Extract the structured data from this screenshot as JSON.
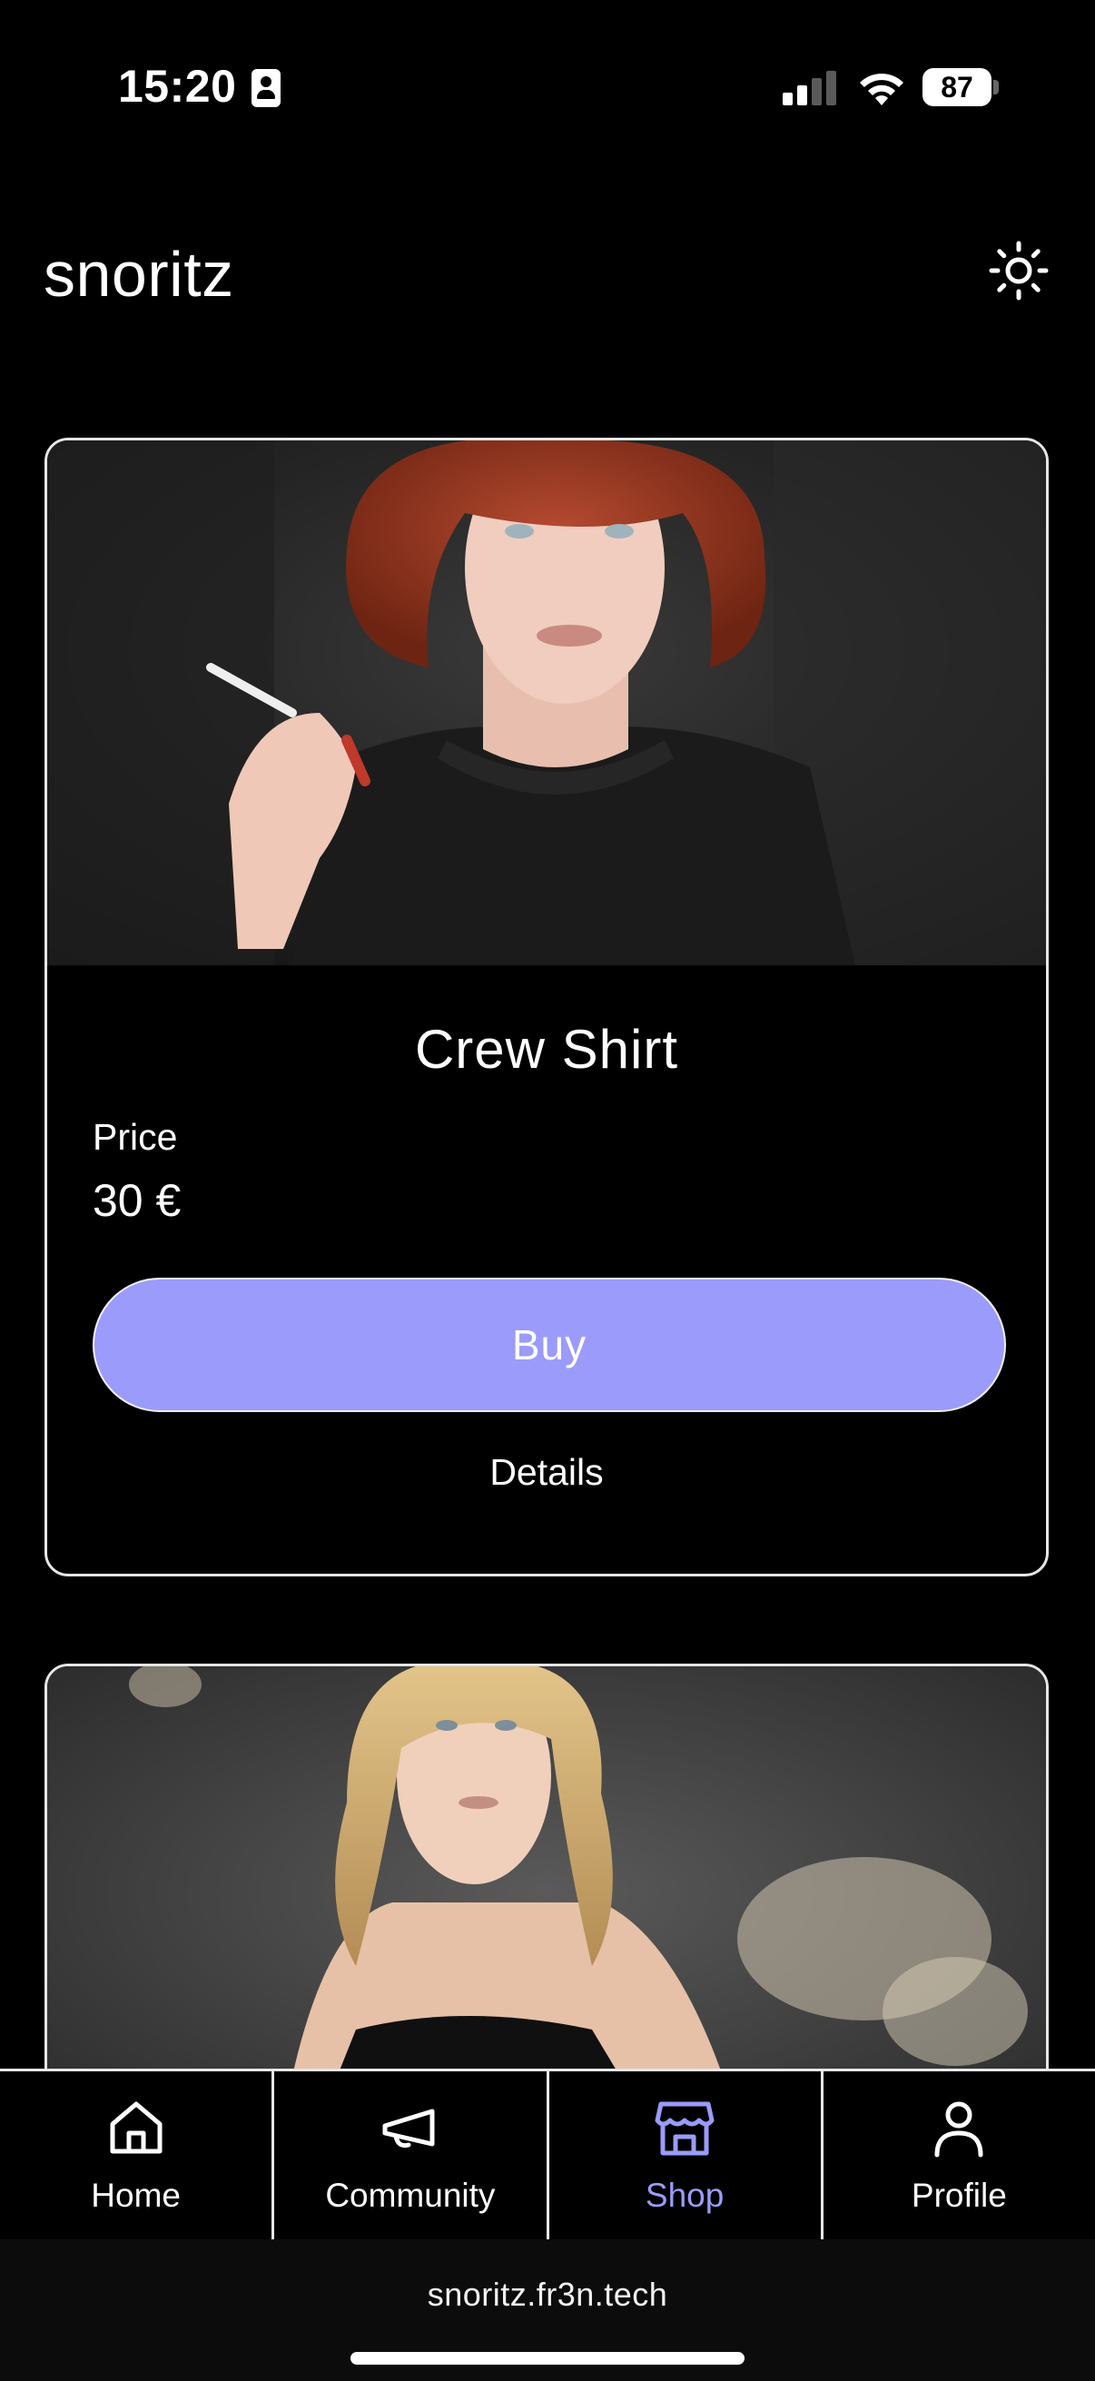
{
  "status_bar": {
    "time": "15:20",
    "battery": "87",
    "icons": [
      "id-badge-icon",
      "signal-icon",
      "wifi-icon",
      "battery-icon"
    ]
  },
  "header": {
    "title": "snoritz",
    "theme_icon": "sun-icon"
  },
  "products": [
    {
      "name": "Crew Shirt",
      "price_label": "Price",
      "price_value": "30 €",
      "buy_label": "Buy",
      "details_label": "Details",
      "photo": "red-haired woman in black t-shirt holding cigarette"
    },
    {
      "photo": "blonde woman in black top against textured wall"
    }
  ],
  "nav": {
    "items": [
      {
        "label": "Home",
        "icon": "home-icon",
        "active": false
      },
      {
        "label": "Community",
        "icon": "megaphone-icon",
        "active": false
      },
      {
        "label": "Shop",
        "icon": "store-icon",
        "active": true
      },
      {
        "label": "Profile",
        "icon": "user-icon",
        "active": false
      }
    ]
  },
  "browser": {
    "url": "snoritz.fr3n.tech"
  },
  "colors": {
    "accent": "#9b9bfb",
    "background": "#000000",
    "border": "#e6e6e6"
  }
}
